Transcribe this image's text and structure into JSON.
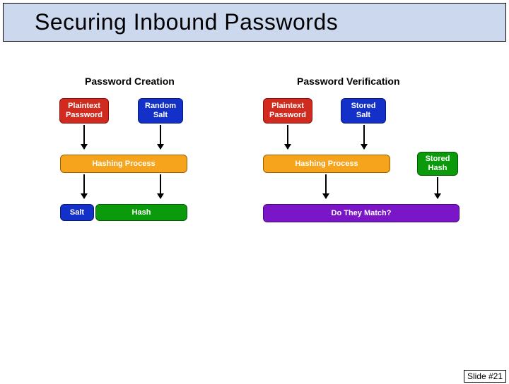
{
  "title": "Securing Inbound Passwords",
  "slide_number": "Slide #21",
  "headers": {
    "left": "Password Creation",
    "right": "Password Verification"
  },
  "creation": {
    "plaintext_l1": "Plaintext",
    "plaintext_l2": "Password",
    "salt_l1": "Random",
    "salt_l2": "Salt",
    "hashing": "Hashing Process",
    "out_salt": "Salt",
    "out_hash": "Hash"
  },
  "verification": {
    "plaintext_l1": "Plaintext",
    "plaintext_l2": "Password",
    "salt_l1": "Stored",
    "salt_l2": "Salt",
    "hashing": "Hashing Process",
    "stored_hash_l1": "Stored",
    "stored_hash_l2": "Hash",
    "match": "Do They Match?"
  }
}
